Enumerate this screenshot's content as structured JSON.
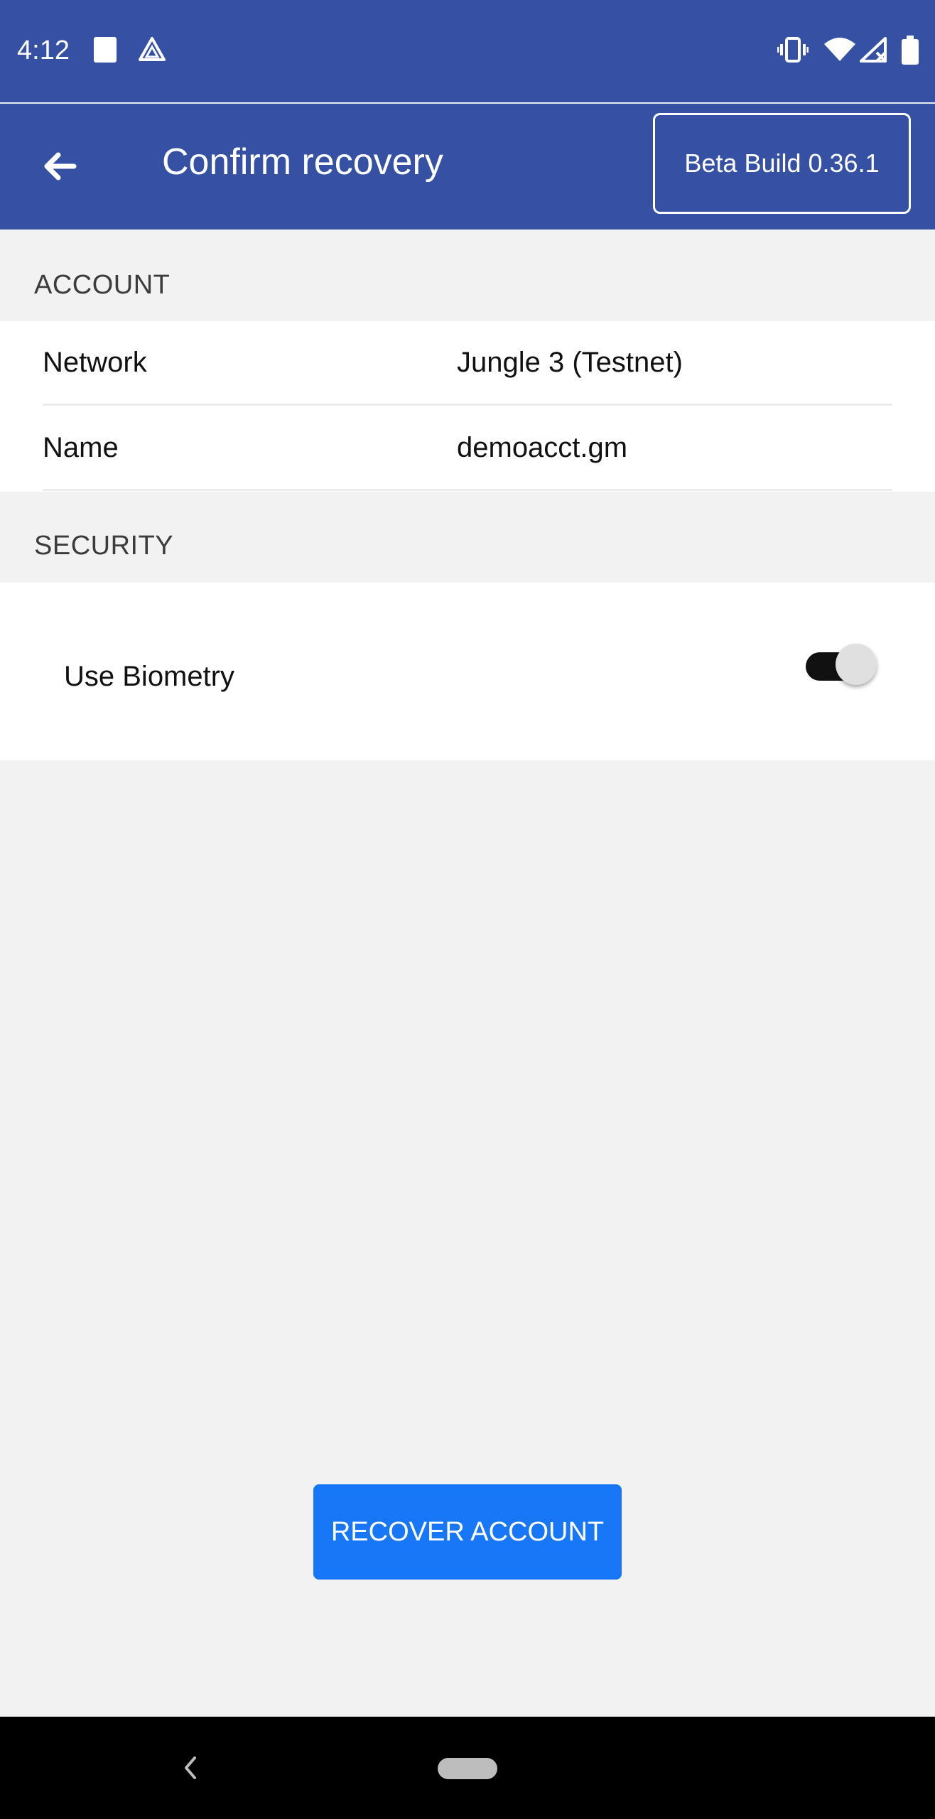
{
  "status_bar": {
    "time": "4:12",
    "icons": [
      "square-notification-icon",
      "drive-icon",
      "vibrate-icon",
      "wifi-icon",
      "signal-off-icon",
      "battery-icon"
    ]
  },
  "app_bar": {
    "title": "Confirm recovery",
    "back_icon": "arrow-left-icon",
    "badge": "Beta Build 0.36.1"
  },
  "account_section": {
    "header": "ACCOUNT",
    "rows": [
      {
        "label": "Network",
        "value": "Jungle 3 (Testnet)"
      },
      {
        "label": "Name",
        "value": "demoacct.gm"
      }
    ]
  },
  "security_section": {
    "header": "SECURITY",
    "biometry_label": "Use Biometry",
    "biometry_enabled": true
  },
  "primary_action": {
    "label": "RECOVER ACCOUNT"
  },
  "nav_bar": {
    "icons": [
      "nav-back-icon",
      "nav-home-pill"
    ]
  },
  "colors": {
    "app_bar": "#3651a4",
    "button": "#1877f7",
    "background": "#f2f2f2"
  }
}
